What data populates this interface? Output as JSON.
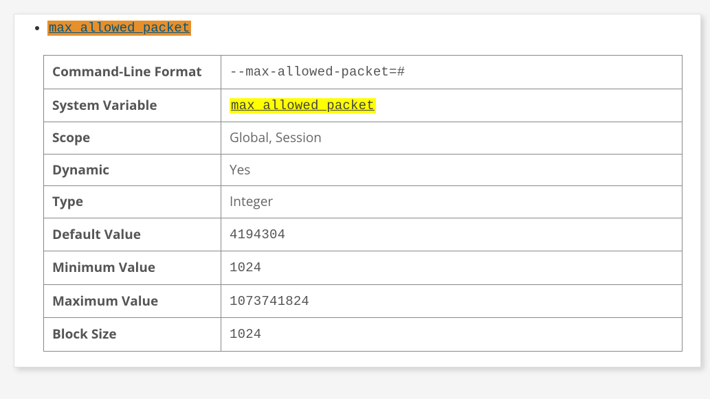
{
  "heading": {
    "text": "max_allowed_packet"
  },
  "rows": {
    "cmd_format": {
      "label": "Command-Line Format",
      "value": "--max-allowed-packet=#"
    },
    "sys_var": {
      "label": "System Variable",
      "value": "max_allowed_packet"
    },
    "scope": {
      "label": "Scope",
      "value": "Global, Session"
    },
    "dynamic": {
      "label": "Dynamic",
      "value": "Yes"
    },
    "type": {
      "label": "Type",
      "value": "Integer"
    },
    "default": {
      "label": "Default Value",
      "value": "4194304"
    },
    "min": {
      "label": "Minimum Value",
      "value": "1024"
    },
    "max": {
      "label": "Maximum Value",
      "value": "1073741824"
    },
    "block": {
      "label": "Block Size",
      "value": "1024"
    }
  }
}
